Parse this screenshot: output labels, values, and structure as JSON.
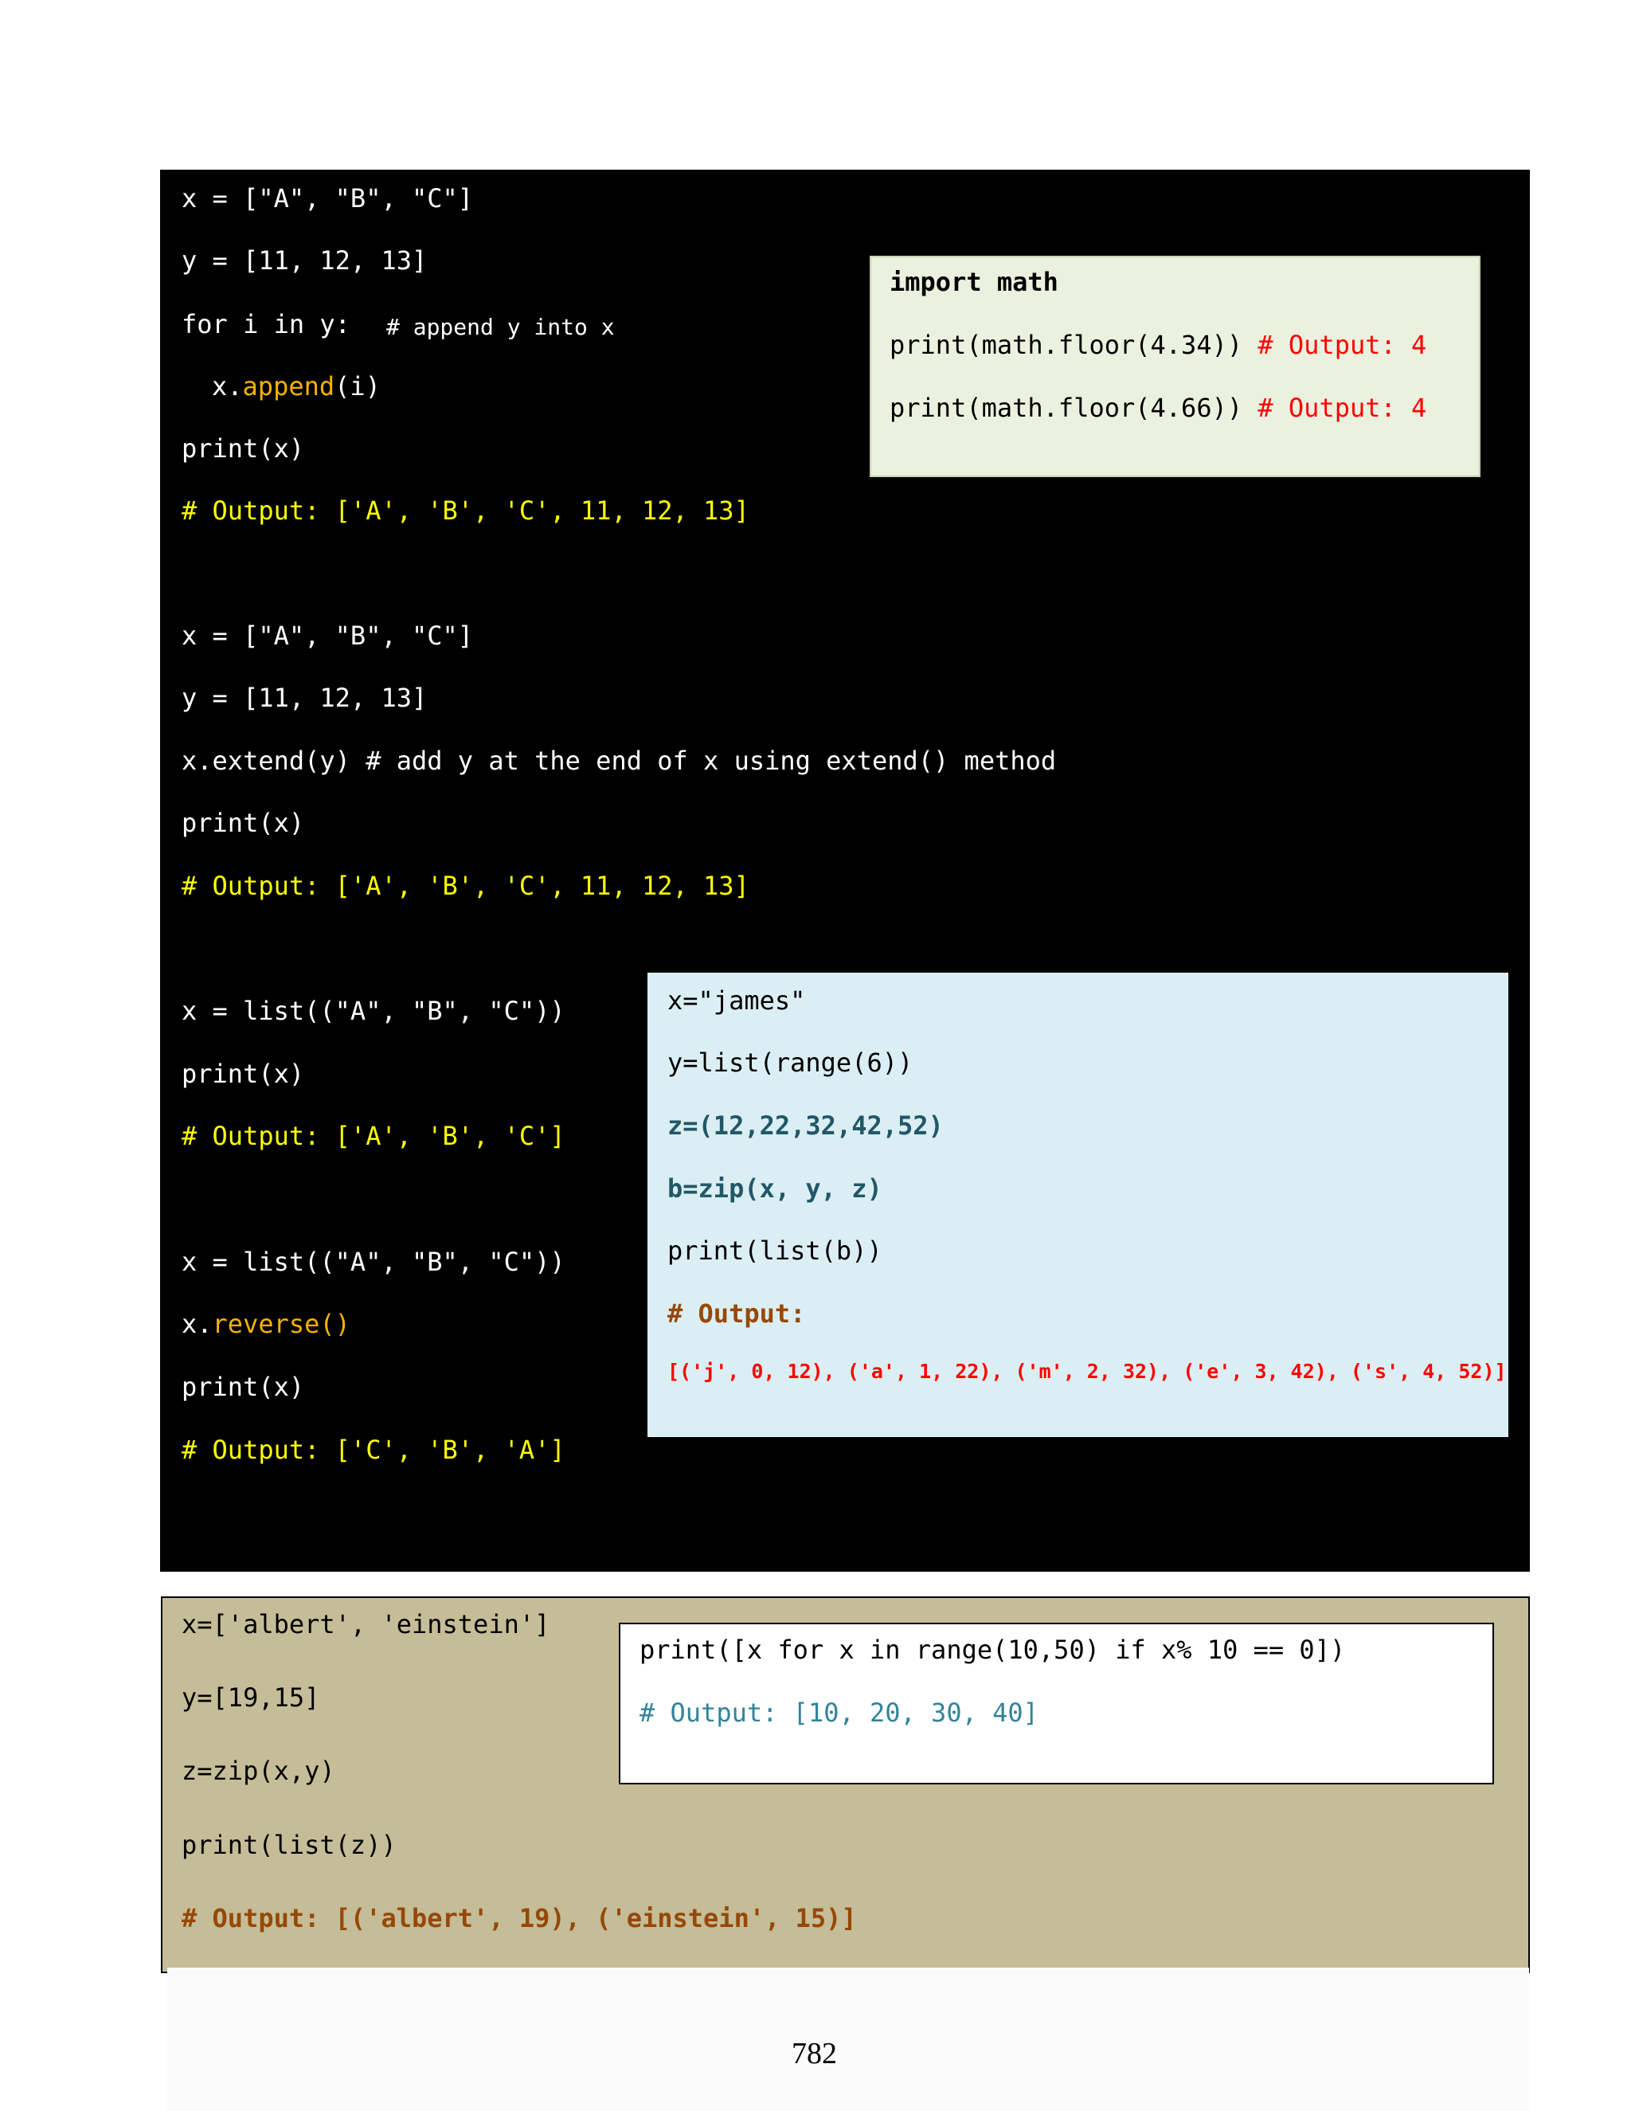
{
  "theme": {
    "black_panel_bg": "#000000",
    "code_white": "#ffffff",
    "output_yellow": "#ffff00",
    "method_orange": "#f5b200",
    "math_box_bg": "#ebf1de",
    "zip_box_bg": "#dbeef3",
    "tan_panel_bg": "#c4bd97",
    "comment_red": "#ff0000",
    "zip_teal": "#215868",
    "output_brown": "#974806",
    "list_comp_comment": "#31849b"
  },
  "black_panel": {
    "block1": {
      "line1": "x = [\"A\", \"B\", \"C\"]",
      "line2": "y = [11, 12, 13]",
      "line3_code": "for i in y:",
      "line3_comment": "# append y into x",
      "line4_prefix": "x.",
      "line4_method": "append",
      "line4_suffix": "(i)",
      "line5": "print(x)",
      "line6": "# Output: ['A', 'B', 'C', 11, 12, 13]"
    },
    "block2": {
      "line1": "x = [\"A\", \"B\", \"C\"]",
      "line2": "y = [11, 12, 13]",
      "line3": "x.extend(y) # add y at the end of x using extend() method",
      "line4": "print(x)",
      "line5": "# Output: ['A', 'B', 'C', 11, 12, 13]"
    },
    "block3": {
      "line1": "x = list((\"A\", \"B\", \"C\"))",
      "line2": "print(x)",
      "line3": "# Output: ['A', 'B', 'C']"
    },
    "block4": {
      "line1": "x = list((\"A\", \"B\", \"C\"))",
      "line2_prefix": "x.",
      "line2_method": "reverse()",
      "line3": "print(x)",
      "line4": "# Output: ['C', 'B', 'A']"
    }
  },
  "math_box": {
    "line1": "import math",
    "line2_code": "print(math.floor(4.34))",
    "line2_comment": "# Output: 4",
    "line3_code": "print(math.floor(4.66))",
    "line3_comment": "# Output: 4"
  },
  "zip_box": {
    "line1": "x=\"james\"",
    "line2": "y=list(range(6))",
    "line3": "z=(12,22,32,42,52)",
    "line4": "b=zip(x, y, z)",
    "line5": "print(list(b))",
    "line6": "# Output:",
    "line7": "[('j', 0, 12), ('a', 1, 22), ('m', 2, 32), ('e', 3, 42), ('s', 4, 52)]"
  },
  "tan_panel": {
    "line1": "x=['albert', 'einstein']",
    "line2": "y=[19,15]",
    "line3": "z=zip(x,y)",
    "line4": "print(list(z))",
    "line5": "# Output: [('albert', 19), ('einstein', 15)]"
  },
  "list_comp_box": {
    "line1": "print([x for x in range(10,50) if x% 10 == 0])",
    "line2": "# Output: [10, 20, 30, 40]"
  },
  "footer": {
    "page_number": "782"
  }
}
